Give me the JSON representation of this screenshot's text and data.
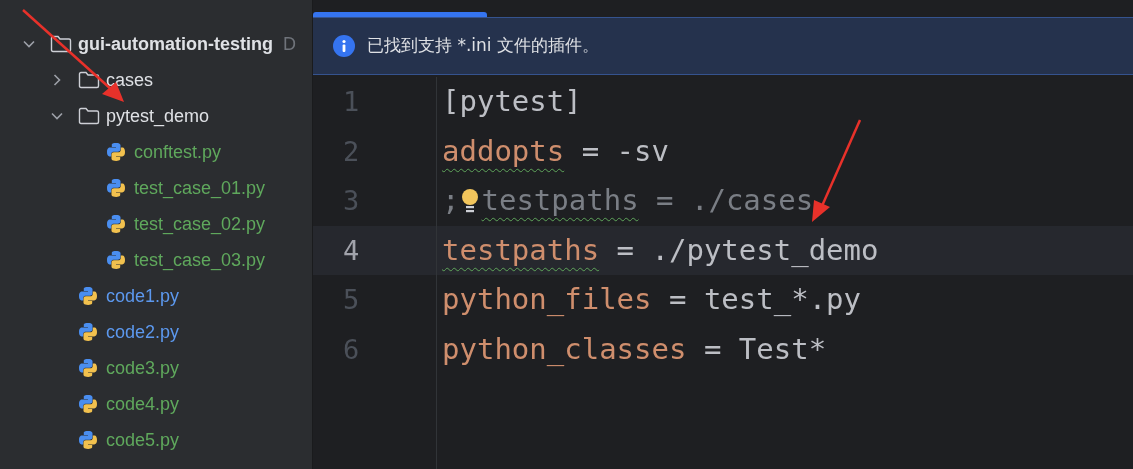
{
  "project_tree": [
    {
      "kind": "folder",
      "name": "gui-automation-testing",
      "hint": "D",
      "expanded": true,
      "children": [
        {
          "kind": "folder",
          "name": "cases",
          "expanded": false
        },
        {
          "kind": "folder",
          "name": "pytest_demo",
          "expanded": true,
          "children": [
            {
              "kind": "python",
              "name": "conftest.py",
              "color": "#5fa85c"
            },
            {
              "kind": "python",
              "name": "test_case_01.py",
              "color": "#5fa85c"
            },
            {
              "kind": "python",
              "name": "test_case_02.py",
              "color": "#5fa85c"
            },
            {
              "kind": "python",
              "name": "test_case_03.py",
              "color": "#5fa85c"
            }
          ]
        },
        {
          "kind": "python",
          "name": "code1.py",
          "color": "#5c98ee"
        },
        {
          "kind": "python",
          "name": "code2.py",
          "color": "#5c98ee"
        },
        {
          "kind": "python",
          "name": "code3.py",
          "color": "#5fa85c"
        },
        {
          "kind": "python",
          "name": "code4.py",
          "color": "#5fa85c"
        },
        {
          "kind": "python",
          "name": "code5.py",
          "color": "#5fa85c"
        }
      ]
    }
  ],
  "notification": {
    "message": "已找到支持 *.ini 文件的插件。"
  },
  "editor": {
    "lines": [
      {
        "number": "1",
        "current": false,
        "tokens": [
          {
            "kind": "plain",
            "text": "[pytest]"
          }
        ]
      },
      {
        "number": "2",
        "current": false,
        "tokens": [
          {
            "kind": "key",
            "text": "addopts",
            "warning": true
          },
          {
            "kind": "plain",
            "text": " = -sv"
          }
        ]
      },
      {
        "number": "3",
        "current": false,
        "tokens": [
          {
            "kind": "comment",
            "text": ";"
          },
          {
            "kind": "bulb"
          },
          {
            "kind": "comment",
            "text": "testpaths",
            "warning": true
          },
          {
            "kind": "comment",
            "text": " = ./cases"
          }
        ]
      },
      {
        "number": "4",
        "current": true,
        "tokens": [
          {
            "kind": "key",
            "text": "testpaths",
            "warning": true
          },
          {
            "kind": "plain",
            "text": " = ./pytest_demo"
          }
        ]
      },
      {
        "number": "5",
        "current": false,
        "tokens": [
          {
            "kind": "key",
            "text": "python_files"
          },
          {
            "kind": "plain",
            "text": " = test_*.py"
          }
        ]
      },
      {
        "number": "6",
        "current": false,
        "tokens": [
          {
            "kind": "key",
            "text": "python_classes"
          },
          {
            "kind": "plain",
            "text": " = Test*"
          }
        ]
      }
    ]
  }
}
